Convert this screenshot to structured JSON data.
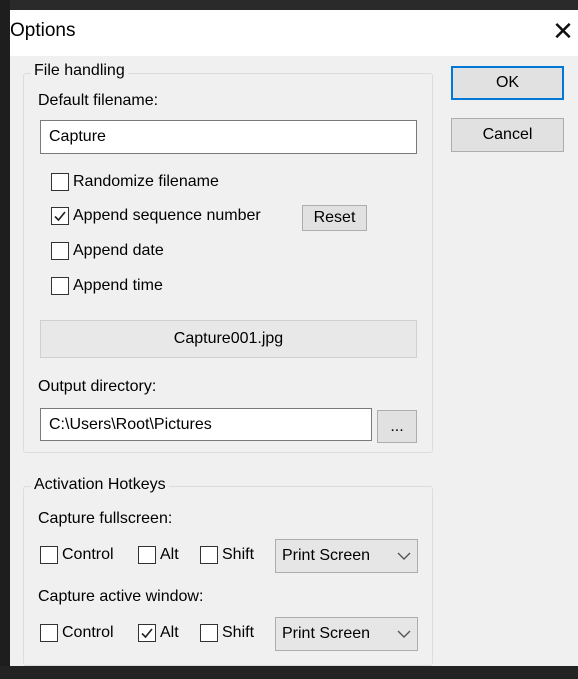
{
  "window": {
    "title": "Options"
  },
  "buttons": {
    "ok": "OK",
    "cancel": "Cancel"
  },
  "file_handling": {
    "legend": "File handling",
    "default_filename_label": "Default filename:",
    "default_filename_value": "Capture",
    "options": [
      {
        "label": "Randomize filename",
        "checked": false
      },
      {
        "label": "Append sequence number",
        "checked": true
      },
      {
        "label": "Append date",
        "checked": false
      },
      {
        "label": "Append time",
        "checked": false
      }
    ],
    "reset_label": "Reset",
    "preview": "Capture001.jpg",
    "output_directory_label": "Output directory:",
    "output_directory_value": "C:\\Users\\Root\\Pictures",
    "browse_label": "..."
  },
  "hotkeys": {
    "legend": "Activation Hotkeys",
    "fullscreen": {
      "label": "Capture fullscreen:",
      "control": {
        "label": "Control",
        "checked": false
      },
      "alt": {
        "label": "Alt",
        "checked": false
      },
      "shift": {
        "label": "Shift",
        "checked": false
      },
      "key": "Print Screen"
    },
    "active_window": {
      "label": "Capture active window:",
      "control": {
        "label": "Control",
        "checked": false
      },
      "alt": {
        "label": "Alt",
        "checked": true
      },
      "shift": {
        "label": "Shift",
        "checked": false
      },
      "key": "Print Screen"
    }
  }
}
